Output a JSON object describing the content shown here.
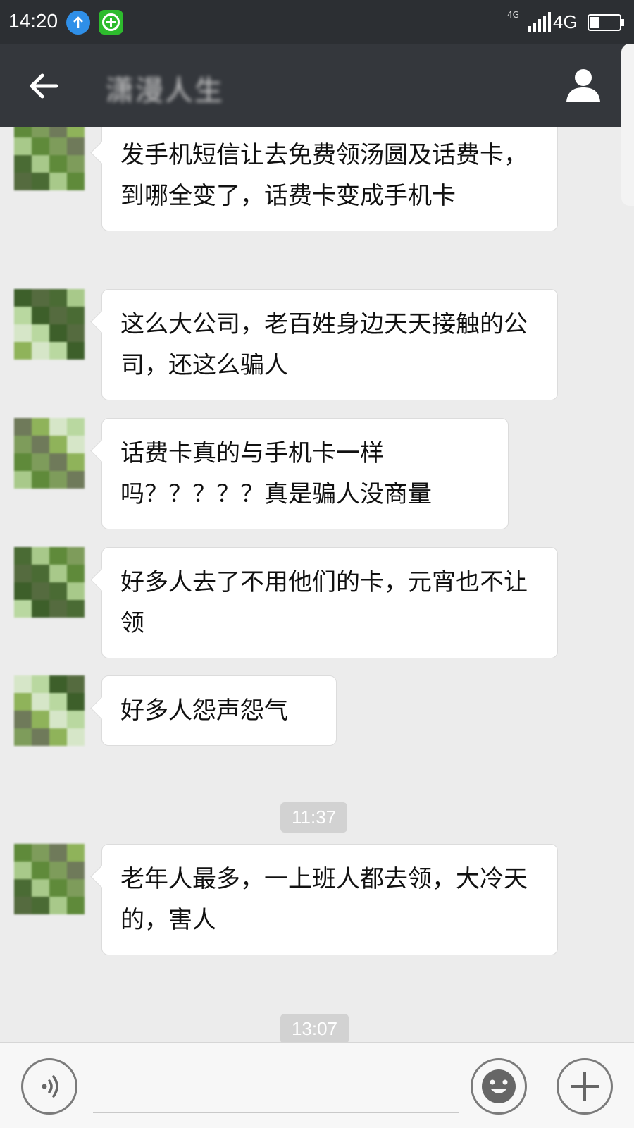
{
  "status_bar": {
    "time": "14:20",
    "network_small": "4G",
    "network": "4G",
    "icons": [
      "upload-icon",
      "app-icon",
      "signal-icon",
      "battery-icon"
    ]
  },
  "header": {
    "title": "潇漫人生",
    "back_icon": "arrow-left-icon",
    "profile_icon": "person-icon"
  },
  "messages": [
    {
      "text": "发手机短信让去免费领汤圆及话费卡，到哪全变了，话费卡变成手机卡"
    },
    {
      "text": "这么大公司，老百姓身边天天接触的公司，还这么骗人"
    },
    {
      "text": "话费卡真的与手机卡一样吗？？？？？真是骗人没商量"
    },
    {
      "text": "好多人去了不用他们的卡，元宵也不让领"
    },
    {
      "text": "好多人怨声怨气"
    },
    {
      "timestamp": "11:37"
    },
    {
      "text": "老年人最多，一上班人都去领，大冷天的，害人"
    },
    {
      "timestamp": "13:07"
    }
  ],
  "input_bar": {
    "voice_icon": "voice-icon",
    "emoji_icon": "smile-icon",
    "plus_icon": "plus-icon"
  },
  "colors": {
    "header_bg": "#34373c",
    "status_bg": "#2c2f33",
    "chat_bg": "#ececec",
    "bubble_bg": "#ffffff",
    "timestamp_bg": "#d2d2d2"
  }
}
